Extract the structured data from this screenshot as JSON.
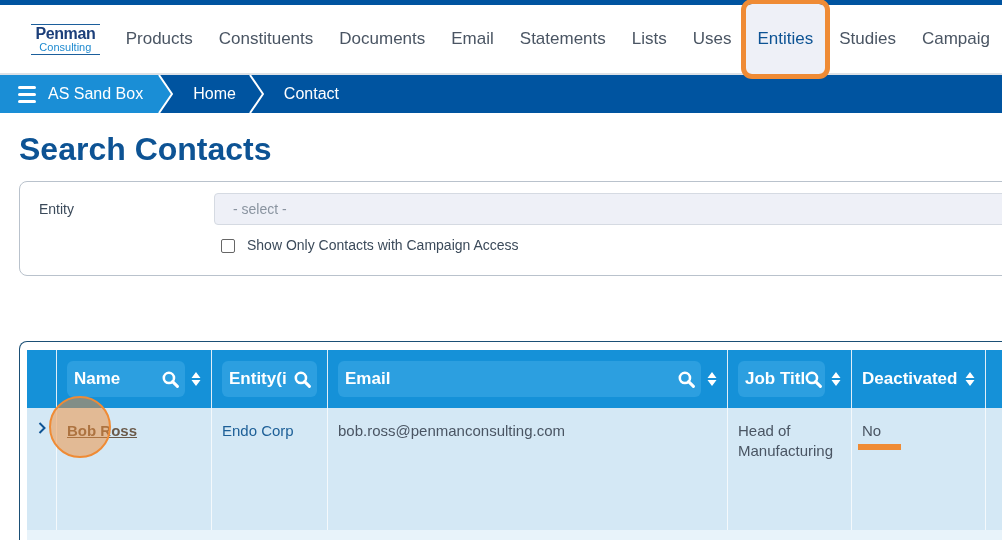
{
  "logo": {
    "line_1": "Penman",
    "line_2": "Consulting"
  },
  "nav": [
    {
      "label": "Products",
      "selected": false,
      "annotated": false
    },
    {
      "label": "Constituents",
      "selected": false,
      "annotated": false
    },
    {
      "label": "Documents",
      "selected": false,
      "annotated": false
    },
    {
      "label": "Email",
      "selected": false,
      "annotated": false
    },
    {
      "label": "Statements",
      "selected": false,
      "annotated": false
    },
    {
      "label": "Lists",
      "selected": false,
      "annotated": false
    },
    {
      "label": "Uses",
      "selected": false,
      "annotated": false
    },
    {
      "label": "Entities",
      "selected": true,
      "annotated": true
    },
    {
      "label": "Studies",
      "selected": false,
      "annotated": false
    },
    {
      "label": "Campaig",
      "selected": false,
      "annotated": false
    }
  ],
  "breadcrumb": [
    {
      "label": "AS Sand Box",
      "kind": "menu"
    },
    {
      "label": "Home",
      "kind": "crumb"
    },
    {
      "label": "Contact",
      "kind": "crumb"
    }
  ],
  "page_title": "Search Contacts",
  "filter": {
    "entity_label": "Entity",
    "entity_placeholder": "- select -",
    "checkbox_label": "Show Only Contacts with Campaign Access",
    "checked": false
  },
  "table": {
    "columns": [
      {
        "label": "Name",
        "search": true,
        "sort": true,
        "pill": true
      },
      {
        "label": "Entity(i",
        "search": true,
        "sort": false,
        "pill": true
      },
      {
        "label": "Email",
        "search": true,
        "sort": true,
        "pill": true
      },
      {
        "label": "Job Titl",
        "search": true,
        "sort": true,
        "pill": true
      },
      {
        "label": "Deactivated",
        "search": false,
        "sort": true,
        "pill": false
      }
    ],
    "rows": [
      {
        "expanded": false,
        "name": "Bob Ross",
        "name_clicked": true,
        "entity": "Endo Corp",
        "email": "bob.ross@penmanconsulting.com",
        "job_title": "Head of Manufacturing",
        "deactivated": "No",
        "deactivated_marked": true
      }
    ]
  }
}
